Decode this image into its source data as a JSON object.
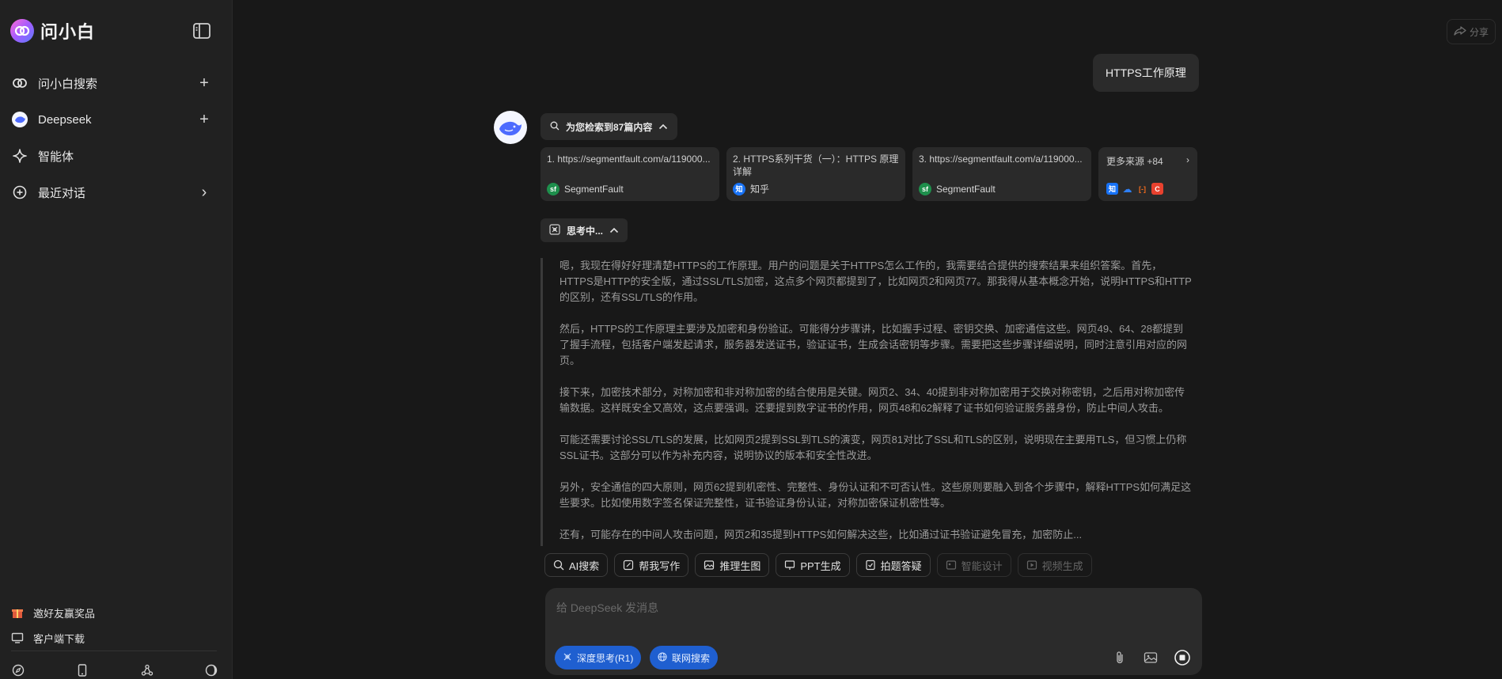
{
  "app": {
    "name": "问小白"
  },
  "sidebar": {
    "items": [
      {
        "label": "问小白搜索",
        "right": "+"
      },
      {
        "label": "Deepseek",
        "right": "+"
      },
      {
        "label": "智能体",
        "right": ""
      },
      {
        "label": "最近对话",
        "right": "›"
      }
    ],
    "bottom_links": [
      {
        "label": "邀好友赢奖品"
      },
      {
        "label": "客户端下载"
      }
    ]
  },
  "header": {
    "share_label": "分享"
  },
  "conversation": {
    "user_message": "HTTPS工作原理",
    "search_summary": "为您检索到87篇内容",
    "sources": [
      {
        "title": "1. https://segmentfault.com/a/119000...",
        "site": "SegmentFault",
        "logo_text": "sf",
        "logo_color": "#1e8f4c"
      },
      {
        "title": "2. HTTPS系列干货（一）：HTTPS 原理详解",
        "site": "知乎",
        "logo_text": "知",
        "logo_color": "#1772f6"
      },
      {
        "title": "3. https://segmentfault.com/a/119000...",
        "site": "SegmentFault",
        "logo_text": "sf",
        "logo_color": "#1e8f4c"
      }
    ],
    "more_sources": {
      "label": "更多来源 +84",
      "arrow": "›",
      "icons": [
        {
          "text": "知",
          "color": "#1772f6"
        },
        {
          "text": "☁",
          "color": "#2e7ff5"
        },
        {
          "text": "[-]",
          "color": "#f26b1d"
        },
        {
          "text": "C",
          "color": "#e8412e"
        }
      ]
    },
    "thinking_label": "思考中...",
    "thinking_paragraphs": [
      "嗯，我现在得好好理清楚HTTPS的工作原理。用户的问题是关于HTTPS怎么工作的，我需要结合提供的搜索结果来组织答案。首先，HTTPS是HTTP的安全版，通过SSL/TLS加密，这点多个网页都提到了，比如网页2和网页77。那我得从基本概念开始，说明HTTPS和HTTP的区别，还有SSL/TLS的作用。",
      "然后，HTTPS的工作原理主要涉及加密和身份验证。可能得分步骤讲，比如握手过程、密钥交换、加密通信这些。网页49、64、28都提到了握手流程，包括客户端发起请求，服务器发送证书，验证证书，生成会话密钥等步骤。需要把这些步骤详细说明，同时注意引用对应的网页。",
      "接下来，加密技术部分，对称加密和非对称加密的结合使用是关键。网页2、34、40提到非对称加密用于交换对称密钥，之后用对称加密传输数据。这样既安全又高效，这点要强调。还要提到数字证书的作用，网页48和62解释了证书如何验证服务器身份，防止中间人攻击。",
      "可能还需要讨论SSL/TLS的发展，比如网页2提到SSL到TLS的演变，网页81对比了SSL和TLS的区别，说明现在主要用TLS，但习惯上仍称SSL证书。这部分可以作为补充内容，说明协议的版本和安全性改进。",
      "另外，安全通信的四大原则，网页62提到机密性、完整性、身份认证和不可否认性。这些原则要融入到各个步骤中，解释HTTPS如何满足这些要求。比如使用数字签名保证完整性，证书验证身份认证，对称加密保证机密性等。",
      "还有，可能存在的中间人攻击问题，网页2和35提到HTTPS如何解决这些，比如通过证书验证避免冒充，加密防止..."
    ]
  },
  "tools": [
    {
      "label": "AI搜索",
      "enabled": true
    },
    {
      "label": "帮我写作",
      "enabled": true
    },
    {
      "label": "推理生图",
      "enabled": true
    },
    {
      "label": "PPT生成",
      "enabled": true
    },
    {
      "label": "拍题答疑",
      "enabled": true
    },
    {
      "label": "智能设计",
      "enabled": false
    },
    {
      "label": "视频生成",
      "enabled": false
    }
  ],
  "composer": {
    "placeholder": "给 DeepSeek 发消息",
    "value": "",
    "deep_think_label": "深度思考(R1)",
    "web_search_label": "联网搜索"
  },
  "colors": {
    "accent": "#1f5fd0",
    "background": "#181818",
    "sidebar": "#212121"
  }
}
